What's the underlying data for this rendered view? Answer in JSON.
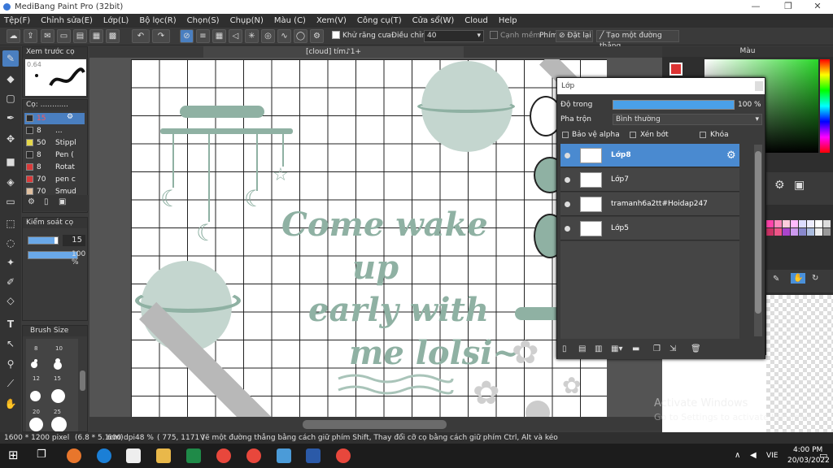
{
  "window": {
    "title": "MediBang Paint Pro (32bit)",
    "minimize": "—",
    "restore": "❐",
    "close": "✕"
  },
  "menu": [
    "Tệp(F)",
    "Chỉnh sửa(E)",
    "Lớp(L)",
    "Bộ lọc(R)",
    "Chọn(S)",
    "Chụp(N)",
    "Màu (C)",
    "Xem(V)",
    "Công cụ(T)",
    "Cửa sổ(W)",
    "Cloud",
    "Help"
  ],
  "toolbar": {
    "antialias_label": "Khử răng cưa",
    "adjust_label": "Điều chỉnh",
    "adjust_value": "40",
    "edge_label": "Cạnh mềm",
    "key_label": "Phím",
    "reset_label": "Đặt lại",
    "line_label": "Tạo một đường thẳng"
  },
  "tools": [
    "brush-tool",
    "eraser-tool",
    "rect-tool",
    "pen-tool",
    "move-tool",
    "fill-tool",
    "bucket-tool",
    "gradient-tool",
    "select-tool",
    "lasso-tool",
    "magic-wand-tool",
    "select-pen-tool",
    "select-eraser-tool",
    "text-tool",
    "operation-tool",
    "eyedropper-tool",
    "dropper-tool",
    "hand-tool"
  ],
  "preview_panel": {
    "title": "Xem trước cọ",
    "size": "0.64"
  },
  "brush_panel": {
    "title": "Cọ: ............",
    "items": [
      {
        "size": "15",
        "name": "",
        "color": "#2b2b2b"
      },
      {
        "size": "8",
        "name": "...",
        "color": "#2b2b2b"
      },
      {
        "size": "50",
        "name": "Stippl",
        "color": "#e6d84a"
      },
      {
        "size": "8",
        "name": "Pen (",
        "color": "#2b2b2b"
      },
      {
        "size": "8",
        "name": "Rotat",
        "color": "#d93a3a"
      },
      {
        "size": "70",
        "name": "pen c",
        "color": "#d93a3a"
      },
      {
        "size": "70",
        "name": "Smud",
        "color": "#e0c0a0"
      }
    ]
  },
  "control_panel": {
    "title": "Kiểm soát cọ",
    "size_value": "15",
    "opacity_value": "100 %",
    "size_fraction": 0.9,
    "opacity_fraction": 1.0
  },
  "brushsize_panel": {
    "title": "Brush Size",
    "labels": [
      "8",
      "10",
      "12",
      "15",
      "20",
      "25"
    ]
  },
  "canvas_tab": "[cloud] tím♪1+",
  "canvas_text": {
    "line1": "Come wake",
    "line2": "up",
    "line3": "early with",
    "line4": "me lolsi~"
  },
  "color_panel": {
    "title": "Màu"
  },
  "layer_dialog": {
    "title": "Lớp",
    "opacity_label": "Độ trong",
    "opacity_value": "100 %",
    "opacity_fraction": 1.0,
    "blend_label": "Pha trộn",
    "blend_value": "Bình thường",
    "protect_alpha": "Bảo vệ alpha",
    "clipping": "Xén bớt",
    "lock": "Khóa",
    "layers": [
      {
        "name": "Lớp8",
        "selected": true
      },
      {
        "name": "Lớp7",
        "selected": false
      },
      {
        "name": "tramanh6a2tt#Hoidap247",
        "selected": false
      },
      {
        "name": "Lớp5",
        "selected": false
      }
    ]
  },
  "statusbar": {
    "size": "1600 * 1200 pixel",
    "physical": "(6.8 * 5.1cm)",
    "dpi": "600 dpi",
    "zoom": "48 %",
    "coords": "( 775, 1171 )",
    "hint": "Vẽ một đường thẳng bằng cách giữ phím Shift, Thay đổi cỡ cọ bằng cách giữ phím Ctrl, Alt và kéo"
  },
  "watermark": {
    "line1": "Activate Windows",
    "line2": "Go to Settings to activate Windows."
  },
  "taskbar": {
    "lang": "VIE",
    "time": "4:00 PM",
    "date": "20/03/2022"
  },
  "colors": {
    "accent": "#4a90d9",
    "sage": "#8fb1a3",
    "pale": "#c4d6cf"
  }
}
